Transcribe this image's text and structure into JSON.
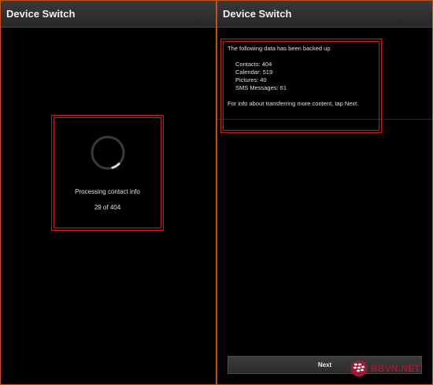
{
  "left_screen": {
    "title": "Device Switch",
    "processing_label": "Processing contact info",
    "processing_count": "29 of 404",
    "progress_fraction": 0.072
  },
  "right_screen": {
    "title": "Device Switch",
    "heading": "The following data has been backed up",
    "items": [
      "Contacts: 404",
      "Calendar: 519",
      "Pictures: 40",
      "SMS Messages: 61"
    ],
    "footer": "For info about transferring more content, tap Next.",
    "next_label": "Next"
  },
  "watermark": {
    "text": "BBVN.NET",
    "color": "#9b1b3a"
  },
  "colors": {
    "frame": "#c0521e",
    "highlight_box": "#d01818"
  }
}
